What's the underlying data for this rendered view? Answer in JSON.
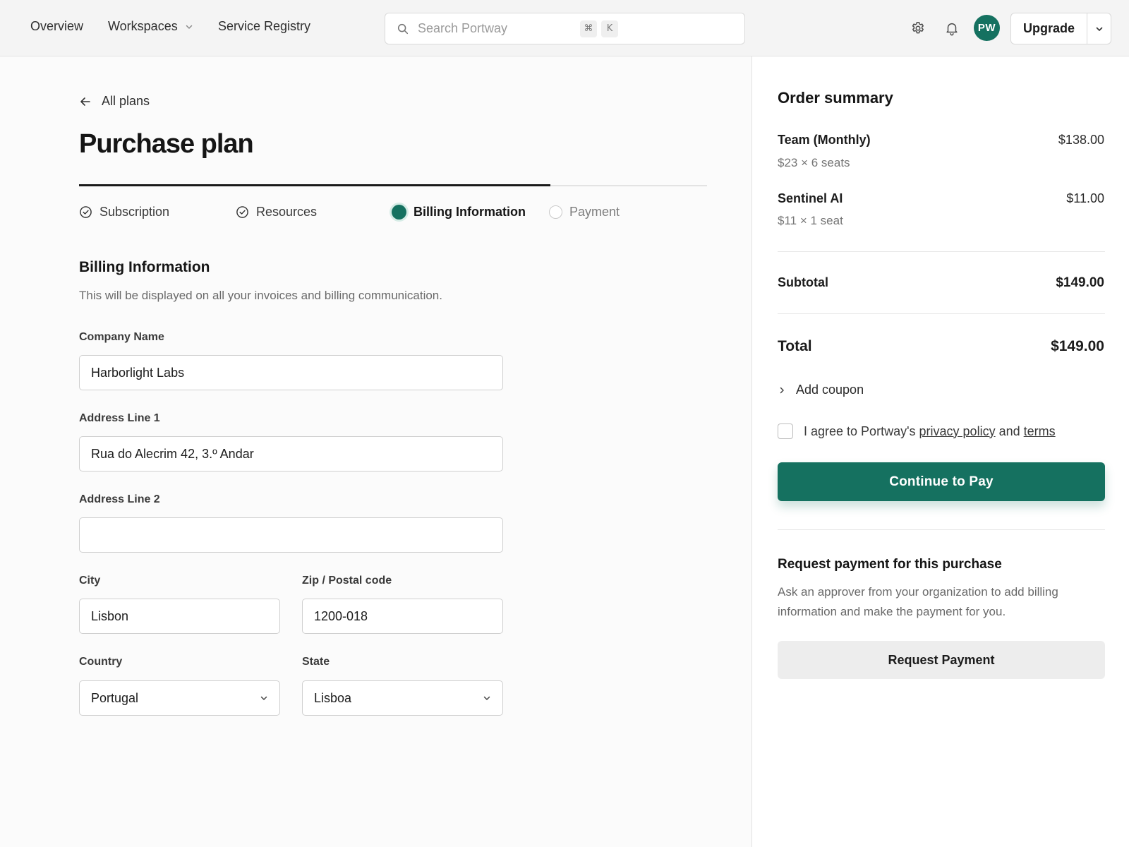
{
  "nav": {
    "links": [
      "Overview",
      "Workspaces",
      "Service Registry"
    ],
    "search_placeholder": "Search Portway",
    "shortcut_keys": [
      "⌘",
      "K"
    ],
    "avatar_initials": "PW",
    "upgrade_label": "Upgrade"
  },
  "main": {
    "back_label": "All plans",
    "title": "Purchase plan",
    "progress_fraction": 0.75,
    "steps": [
      {
        "label": "Subscription",
        "state": "done"
      },
      {
        "label": "Resources",
        "state": "done"
      },
      {
        "label": "Billing Information",
        "state": "active"
      },
      {
        "label": "Payment",
        "state": "pending"
      }
    ],
    "section_title": "Billing Information",
    "section_desc": "This will be displayed on all your invoices and billing communication.",
    "fields": {
      "company": {
        "label": "Company Name",
        "value": "Harborlight Labs"
      },
      "address1": {
        "label": "Address Line 1",
        "value": "Rua do Alecrim 42, 3.º Andar"
      },
      "address2": {
        "label": "Address Line 2",
        "value": ""
      },
      "city": {
        "label": "City",
        "value": "Lisbon"
      },
      "zip": {
        "label": "Zip / Postal code",
        "value": "1200-018"
      },
      "country": {
        "label": "Country",
        "value": "Portugal"
      },
      "state": {
        "label": "State",
        "value": "Lisboa"
      }
    }
  },
  "summary": {
    "title": "Order summary",
    "items": [
      {
        "name": "Team (Monthly)",
        "detail": "$23 × 6 seats",
        "price": "$138.00"
      },
      {
        "name": "Sentinel AI",
        "detail": "$11 × 1 seat",
        "price": "$11.00"
      }
    ],
    "subtotal_label": "Subtotal",
    "subtotal_value": "$149.00",
    "total_label": "Total",
    "total_value": "$149.00",
    "coupon_label": "Add coupon",
    "agree_prefix": "I agree to Portway's",
    "agree_privacy": "privacy policy",
    "agree_and": "and",
    "agree_terms": "terms",
    "agree_checked": false,
    "pay_label": "Continue to Pay",
    "request_title": "Request payment for this purchase",
    "request_desc": "Ask an approver from your organization to add billing information and make the payment for you.",
    "request_label": "Request Payment"
  },
  "colors": {
    "accent": "#157160",
    "page_bg": "#fbfbfb",
    "topbar_bg": "#f4f4f4"
  },
  "icons": {
    "search": "search-icon",
    "settings": "gear-icon",
    "notifications": "bell-icon",
    "back": "arrow-left-icon",
    "step_done": "check-circle-icon",
    "dropdown": "chevron-down-icon",
    "coupon": "chevron-right-icon"
  }
}
